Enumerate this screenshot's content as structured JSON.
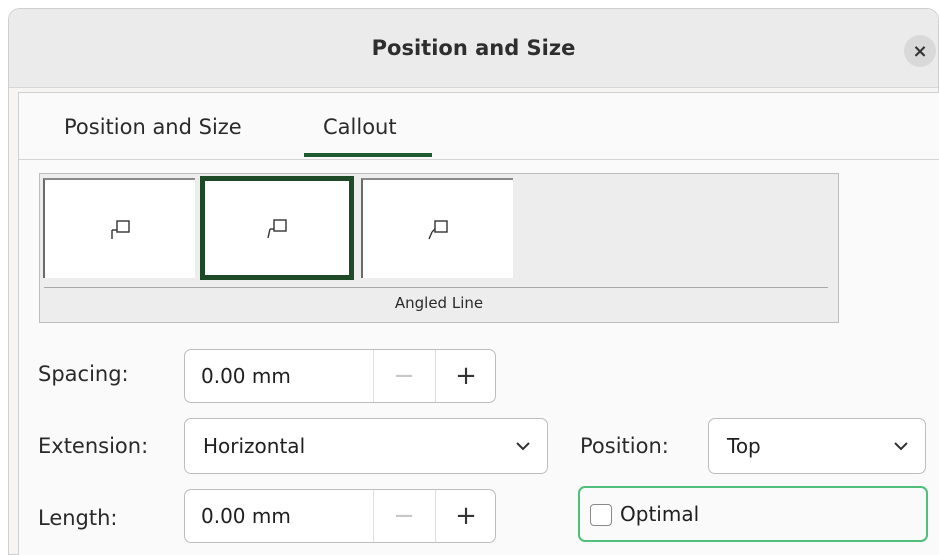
{
  "dialog": {
    "title": "Position and Size",
    "close_label": "×"
  },
  "tabs": [
    {
      "label": "Position and Size",
      "selected": false
    },
    {
      "label": "Callout",
      "selected": true
    }
  ],
  "callout": {
    "styles_label": "Angled Line",
    "selected_style_index": 1
  },
  "fields": {
    "spacing": {
      "label": "Spacing:",
      "value": "0.00 mm",
      "minus": "−",
      "plus": "+"
    },
    "extension": {
      "label": "Extension:",
      "value": "Horizontal"
    },
    "position": {
      "label": "Position:",
      "value": "Top"
    },
    "length": {
      "label": "Length:",
      "value": "0.00 mm",
      "minus": "−",
      "plus": "+"
    },
    "optimal": {
      "label": "Optimal",
      "checked": false
    }
  },
  "colors": {
    "accent": "#1f5a30",
    "focus": "#4fbf79"
  }
}
